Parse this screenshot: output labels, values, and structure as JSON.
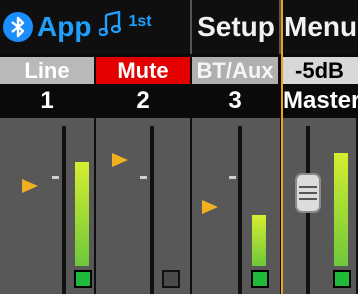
{
  "header": {
    "app_label": "App",
    "superscript": "1st",
    "setup_label": "Setup",
    "menu_label": "Menu"
  },
  "channels": [
    {
      "input_label": "Line",
      "number": "1",
      "signal_on": true
    },
    {
      "input_label": "Mute",
      "number": "2",
      "signal_on": false
    },
    {
      "input_label": "BT/Aux",
      "number": "3",
      "signal_on": true
    }
  ],
  "master": {
    "level": "-5dB",
    "label": "Master",
    "signal_on": true
  },
  "colors": {
    "accent": "#1ea0ff",
    "mute_red": "#e40000",
    "master_outline": "#f0a020",
    "pointer": "#f0b020",
    "led_on": "#1fba3a"
  },
  "icons": [
    "bluetooth-icon",
    "music-note-icon",
    "fader-knob-icon"
  ]
}
